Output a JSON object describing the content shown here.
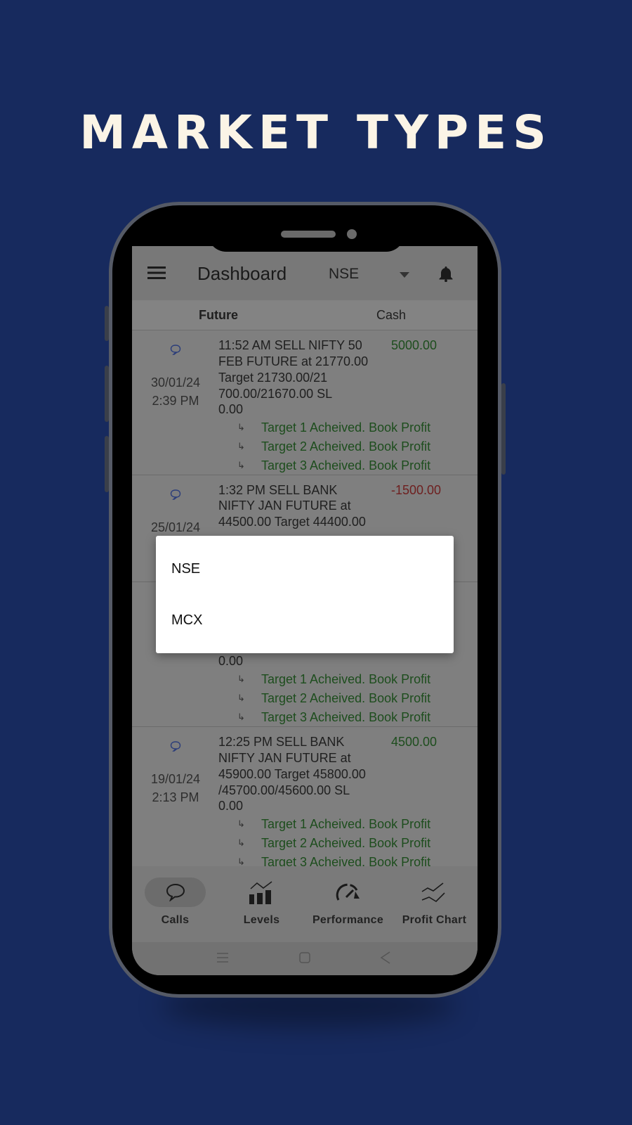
{
  "banner_title": "MARKET TYPES",
  "header": {
    "title": "Dashboard",
    "market_selected": "NSE",
    "icons": [
      "menu-icon",
      "chevron-down-icon",
      "bell-icon"
    ]
  },
  "tabs": [
    {
      "label": "Future",
      "active": true
    },
    {
      "label": "Cash",
      "active": false
    }
  ],
  "calls": [
    {
      "date": "30/01/24",
      "time": "2:39 PM",
      "lines": [
        "11:52 AM SELL NIFTY 50",
        "FEB FUTURE at 21770.00",
        "Target 21730.00/21",
        "700.00/21670.00 SL",
        "0.00"
      ],
      "amount": "5000.00",
      "targets": [
        "Target 1 Acheived. Book Profit",
        "Target 2 Acheived. Book Profit",
        "Target 3 Acheived. Book Profit"
      ]
    },
    {
      "date": "25/01/24",
      "lines": [
        "1:32 PM SELL BANK",
        "NIFTY JAN FUTURE at",
        "44500.00 Target 44400.00"
      ],
      "amount": "-1500.00"
    },
    {
      "lines": [
        "0.00"
      ],
      "targets": [
        "Target 1 Acheived. Book Profit",
        "Target 2 Acheived. Book Profit",
        "Target 3 Acheived. Book Profit"
      ]
    },
    {
      "date": "19/01/24",
      "time": "2:13 PM",
      "lines": [
        "12:25 PM SELL BANK",
        "NIFTY JAN FUTURE at",
        "45900.00 Target 45800.00",
        "/45700.00/45600.00 SL",
        "0.00"
      ],
      "amount": "4500.00",
      "targets": [
        "Target 1 Acheived. Book Profit",
        "Target 2 Acheived. Book Profit",
        "Target 3 Acheived. Book Profit"
      ]
    }
  ],
  "bottom_nav": [
    {
      "label": "Calls",
      "icon": "chat-bubble-icon",
      "active": true
    },
    {
      "label": "Levels",
      "icon": "bar-chart-icon"
    },
    {
      "label": "Performance",
      "icon": "speedometer-icon"
    },
    {
      "label": "Profit Chart",
      "icon": "trend-lines-icon"
    }
  ],
  "dropdown": {
    "options": [
      "NSE",
      "MCX"
    ]
  },
  "colors": {
    "background": "#172a5e",
    "profit": "#1d4d1d",
    "loss": "#6e1f1f"
  }
}
